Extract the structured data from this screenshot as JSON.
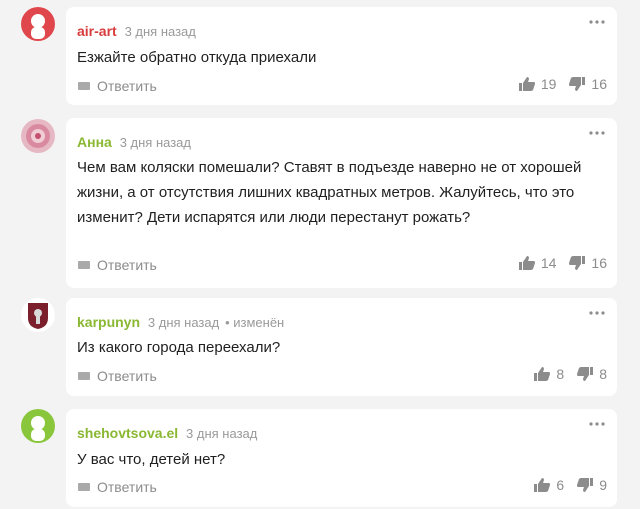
{
  "accent": {
    "reply_text": "#8c8c8c",
    "meta_text": "#9a9a9a"
  },
  "comments": [
    {
      "author": "air-art",
      "author_color": "#d83b3b",
      "time": "3 дня назад",
      "edited": "",
      "text": "Езжайте обратно откуда приехали",
      "reply_label": "Ответить",
      "likes": "19",
      "dislikes": "16",
      "avatar_color": "#e0474c",
      "avatar_icon": "person-icon"
    },
    {
      "author": "Анна",
      "author_color": "#8ab832",
      "time": "3 дня назад",
      "edited": "",
      "text": "Чем вам коляски помешали? Ставят в подъезде наверно не от хорошей жизни, а от отсутствия лишних квадратных метров. Жалуйтесь, что это изменит? Дети испарятся или люди перестанут рожать?",
      "reply_label": "Ответить",
      "likes": "14",
      "dislikes": "16",
      "avatar_color": "#e6b8c4",
      "avatar_icon": "flower-photo"
    },
    {
      "author": "karpunyn",
      "author_color": "#8ab832",
      "time": "3 дня назад",
      "edited": "• изменён",
      "text": "Из какого города переехали?",
      "reply_label": "Ответить",
      "likes": "8",
      "dislikes": "8",
      "avatar_color": "#7a1f2b",
      "avatar_icon": "coat-of-arms-icon"
    },
    {
      "author": "shehovtsova.el",
      "author_color": "#8ab832",
      "time": "3 дня назад",
      "edited": "",
      "text": "У вас что, детей нет?",
      "reply_label": "Ответить",
      "likes": "6",
      "dislikes": "9",
      "avatar_color": "#8ac63c",
      "avatar_icon": "person-icon"
    }
  ]
}
